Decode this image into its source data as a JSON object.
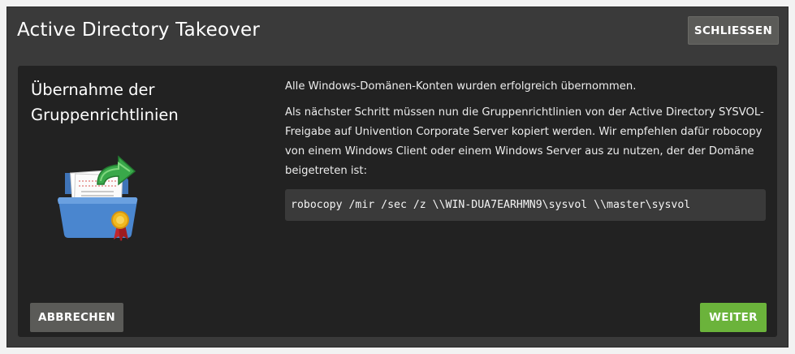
{
  "dialog": {
    "title": "Active Directory Takeover",
    "close_label": "SCHLIESSEN"
  },
  "panel": {
    "heading_line1": "Übernahme der",
    "heading_line2": "Gruppenrichtlinien",
    "icon": "folder-with-certificate-and-green-arrow-icon",
    "paragraph1": "Alle Windows-Domänen-Konten wurden erfolgreich übernommen.",
    "paragraph2": "Als nächster Schritt müssen nun die Gruppenrichtlinien von der Active Directory SYSVOL-Freigabe auf Univention Corporate Server kopiert werden. Wir empfehlen dafür robocopy von einem Windows Client oder einem Windows Server aus zu nutzen, der der Domäne beigetreten ist:",
    "command": "robocopy /mir /sec /z \\\\WIN-DUA7EARHMN9\\sysvol \\\\master\\sysvol"
  },
  "footer": {
    "cancel_label": "ABBRECHEN",
    "next_label": "WEITER"
  },
  "colors": {
    "window_bg": "#3a3a3a",
    "panel_bg": "#222222",
    "next_button": "#6bb33b",
    "secondary_button": "#5b5b58"
  }
}
